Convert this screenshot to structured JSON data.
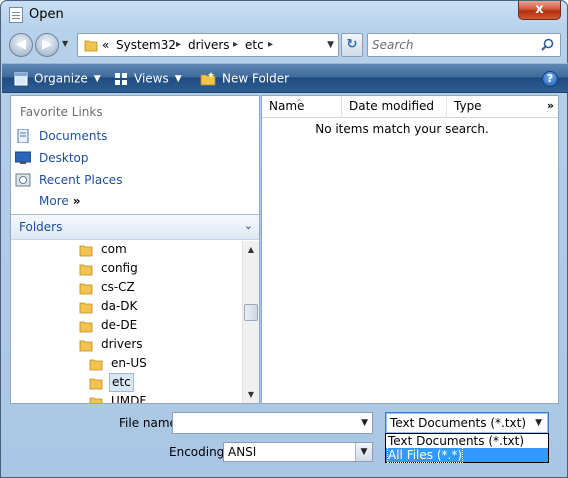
{
  "window": {
    "title": "Open",
    "close_label": "x"
  },
  "navigation": {
    "back_icon": "back-arrow-icon",
    "forward_icon": "forward-arrow-icon",
    "address": {
      "overflow": "«",
      "segments": [
        "System32",
        "drivers",
        "etc"
      ]
    },
    "search": {
      "placeholder": "Search",
      "value": ""
    }
  },
  "toolbar": {
    "organize_label": "Organize",
    "views_label": "Views",
    "new_folder_label": "New Folder",
    "help_label": "?"
  },
  "favorites": {
    "title": "Favorite Links",
    "items": [
      {
        "label": "Documents",
        "icon": "documents-icon"
      },
      {
        "label": "Desktop",
        "icon": "desktop-icon"
      },
      {
        "label": "Recent Places",
        "icon": "recent-places-icon"
      }
    ],
    "more_label": "More",
    "more_chevron": "»"
  },
  "folders": {
    "title": "Folders",
    "items": [
      {
        "label": "com",
        "selected": false
      },
      {
        "label": "config",
        "selected": false
      },
      {
        "label": "cs-CZ",
        "selected": false
      },
      {
        "label": "da-DK",
        "selected": false
      },
      {
        "label": "de-DE",
        "selected": false
      },
      {
        "label": "drivers",
        "selected": false
      },
      {
        "label": "en-US",
        "selected": false
      },
      {
        "label": "etc",
        "selected": true
      },
      {
        "label": "UMDF",
        "selected": false
      }
    ]
  },
  "file_list": {
    "columns": [
      "Name",
      "Date modified",
      "Type"
    ],
    "more_columns": "»",
    "sort_indicator": "^",
    "empty_message": "No items match your search."
  },
  "bottom": {
    "filename_label": "File name:",
    "filename_value": "",
    "encoding_label": "Encoding:",
    "encoding_value": "ANSI",
    "filetype_value": "Text Documents (*.txt)",
    "filetype_options": [
      "Text Documents (*.txt)",
      "All Files  (*.*)"
    ],
    "filetype_highlighted_index": 1
  },
  "colors": {
    "toolbar": "#2f5d91",
    "link": "#1c4fa3",
    "selection": "#3399ff",
    "folder": "#f2c44f"
  }
}
